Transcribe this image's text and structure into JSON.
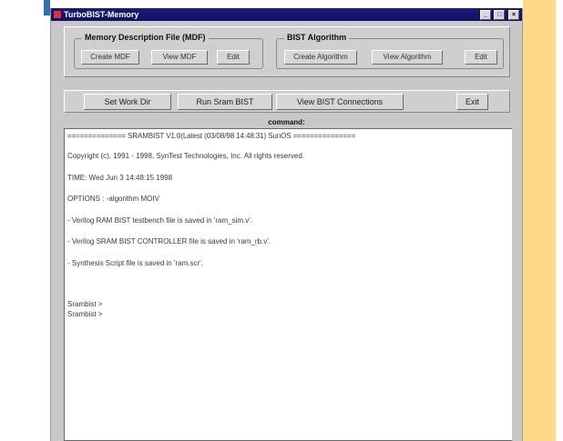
{
  "window": {
    "title": "TurboBIST-Memory",
    "minimize_label": "_",
    "maximize_label": "□",
    "close_label": "×"
  },
  "mdf_group": {
    "label": "Memory Description File (MDF)",
    "buttons": [
      "Create MDF",
      "View MDF",
      "Edit"
    ]
  },
  "bist_group": {
    "label": "BIST Algorithm",
    "buttons": [
      "Create Algorithm",
      "View Algorithm",
      "Edit"
    ]
  },
  "actions": [
    "Set Work Dir",
    "Run Sram BIST",
    "View BIST Connections",
    "Exit"
  ],
  "command_label": "command:",
  "console": {
    "lines": [
      "============== SRAMBIST V1.0(Latest (03/08/98 14:48:31) SunOS ===============",
      "Copyright (c), 1991 - 1998, SynTest Technologies, Inc. All rights reserved.",
      "TIME: Wed Jun 3 14:48:15 1998",
      "OPTIONS : -algorithm MOIV",
      "- Verilog RAM BIST testbench file is saved in 'ram_sim.v'.",
      "- Verilog SRAM BIST CONTROLLER file is saved in 'ram_rb.v'.",
      "- Synthesis Script file is saved in 'ram.scr'.",
      "Srambist >",
      " Srambist >"
    ]
  },
  "scrollbar": {
    "up_icon": "▲",
    "down_icon": "▼"
  }
}
